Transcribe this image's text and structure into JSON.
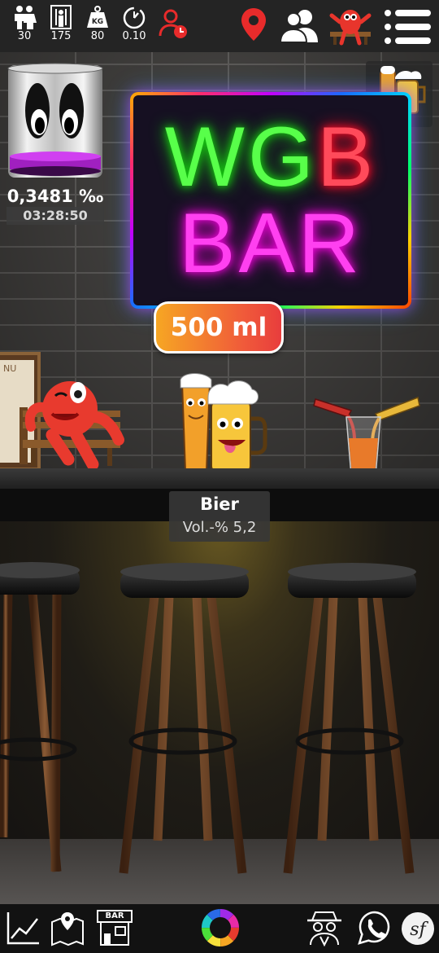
{
  "stats": [
    {
      "icon": "people-icon",
      "value": "30"
    },
    {
      "icon": "height-icon",
      "value": "175"
    },
    {
      "icon": "weight-icon",
      "value": "80"
    },
    {
      "icon": "timer-icon",
      "value": "0.10"
    }
  ],
  "sign": {
    "line1_green": "WG",
    "line1_red": "B",
    "line2": "BAR"
  },
  "volume": "500 ml",
  "promille": {
    "value": "0,3481 ‰",
    "time": "03:28:50"
  },
  "drink": {
    "name": "Bier",
    "abv": "Vol.-% 5,2"
  },
  "colors": {
    "accent": "#f6a623",
    "neon_pink": "#ff40f0",
    "neon_green": "#58ff4a",
    "neon_red": "#ff4a5a",
    "location_pin": "#e82b2b"
  },
  "bottom_nav": [
    "chart-icon",
    "map-icon",
    "bar-icon",
    "color-wheel-icon",
    "spy-icon",
    "whatsapp-icon",
    "sf-icon"
  ],
  "bar_sign_text": "BAR",
  "menu_board_text": "NU"
}
